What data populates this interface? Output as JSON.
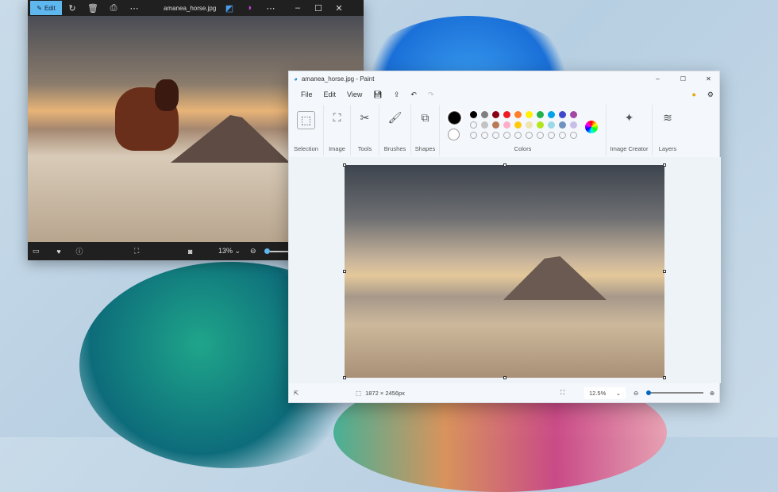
{
  "photos": {
    "edit_label": "Edit",
    "filename": "amanea_horse.jpg",
    "zoom": "13%",
    "zoom_slider_fraction": 0.05
  },
  "paint": {
    "title": "amanea_horse.jpg - Paint",
    "menu": [
      "File",
      "Edit",
      "View"
    ],
    "groups": {
      "selection": "Selection",
      "image": "Image",
      "tools": "Tools",
      "brushes": "Brushes",
      "shapes": "Shapes",
      "colors": "Colors",
      "image_creator": "Image Creator",
      "layers": "Layers"
    },
    "palette_row1": [
      "#000000",
      "#7f7f7f",
      "#880015",
      "#ed1c24",
      "#ff7f27",
      "#fff200",
      "#22b14c",
      "#00a2e8",
      "#3f48cc",
      "#a349a4"
    ],
    "palette_row2": [
      "#ffffff",
      "#c3c3c3",
      "#b97a57",
      "#ffaec9",
      "#ffc90e",
      "#efe4b0",
      "#b5e61d",
      "#99d9ea",
      "#7092be",
      "#c8bfe7"
    ],
    "status": {
      "dimensions": "1872 × 2456px",
      "zoom": "12.5%",
      "zoom_slider_fraction": 0.02
    }
  }
}
